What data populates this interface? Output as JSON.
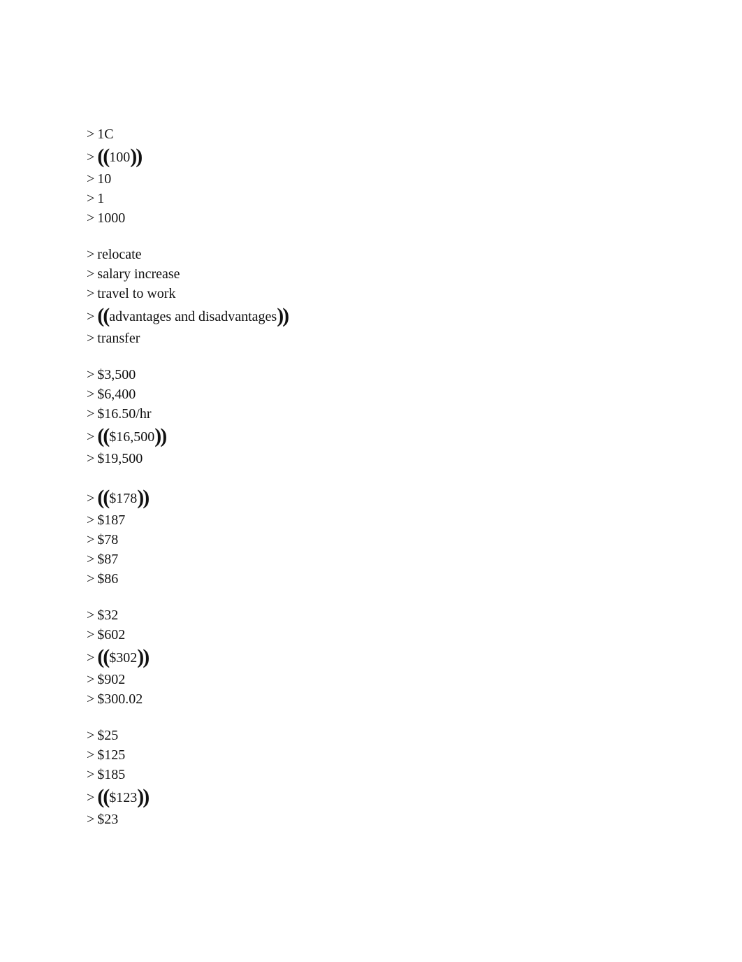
{
  "document": {
    "marker": ">",
    "selection_open": "((",
    "selection_close": "))",
    "groups": [
      {
        "options": [
          {
            "text": "1C",
            "selected": false
          },
          {
            "text": "100",
            "selected": true
          },
          {
            "text": "10",
            "selected": false
          },
          {
            "text": "1",
            "selected": false
          },
          {
            "text": "1000",
            "selected": false
          }
        ]
      },
      {
        "options": [
          {
            "text": "relocate",
            "selected": false
          },
          {
            "text": "salary increase",
            "selected": false
          },
          {
            "text": "travel to work",
            "selected": false
          },
          {
            "text": "advantages and disadvantages",
            "selected": true
          },
          {
            "text": "transfer",
            "selected": false
          }
        ]
      },
      {
        "options": [
          {
            "text": "$3,500",
            "selected": false
          },
          {
            "text": "$6,400",
            "selected": false
          },
          {
            "text": "$16.50/hr",
            "selected": false
          },
          {
            "text": "$16,500",
            "selected": true
          },
          {
            "text": "$19,500",
            "selected": false
          }
        ]
      },
      {
        "options": [
          {
            "text": "$178",
            "selected": true
          },
          {
            "text": "$187",
            "selected": false
          },
          {
            "text": "$78",
            "selected": false
          },
          {
            "text": "$87",
            "selected": false
          },
          {
            "text": "$86",
            "selected": false
          }
        ]
      },
      {
        "options": [
          {
            "text": "$32",
            "selected": false
          },
          {
            "text": "$602",
            "selected": false
          },
          {
            "text": "$302",
            "selected": true
          },
          {
            "text": "$902",
            "selected": false
          },
          {
            "text": "$300.02",
            "selected": false
          }
        ]
      },
      {
        "options": [
          {
            "text": "$25",
            "selected": false
          },
          {
            "text": "$125",
            "selected": false
          },
          {
            "text": "$185",
            "selected": false
          },
          {
            "text": "$123",
            "selected": true
          },
          {
            "text": "$23",
            "selected": false
          }
        ]
      }
    ]
  }
}
